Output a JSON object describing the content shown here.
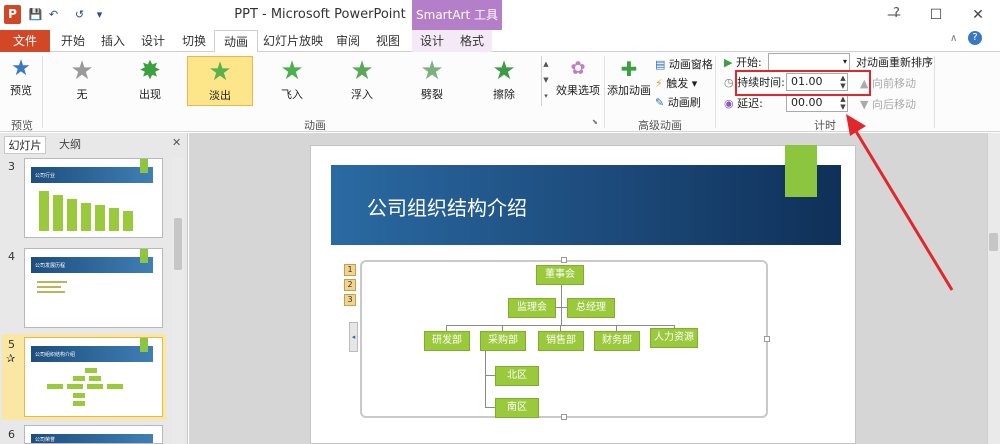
{
  "window": {
    "title": "PPT - Microsoft PowerPoint",
    "contextual_tab_label": "SmartArt 工具",
    "minimize": "—",
    "maximize": "☐",
    "close": "✕"
  },
  "qat": {
    "save": "💾",
    "undo": "↶",
    "redo": "↺",
    "customize": "▾"
  },
  "tabs": [
    "文件",
    "开始",
    "插入",
    "设计",
    "切换",
    "动画",
    "幻灯片放映",
    "审阅",
    "视图",
    "设计",
    "格式"
  ],
  "ribbon": {
    "preview": {
      "label": "预览",
      "group": "预览"
    },
    "animation_group": "动画",
    "animations": [
      {
        "label": "无",
        "color": "#9a9a9a"
      },
      {
        "label": "出现",
        "color": "#3aa040"
      },
      {
        "label": "淡出",
        "color": "#5bb24c"
      },
      {
        "label": "飞入",
        "color": "#4caf50"
      },
      {
        "label": "浮入",
        "color": "#5aa85a"
      },
      {
        "label": "劈裂",
        "color": "#7cb07c"
      },
      {
        "label": "擦除",
        "color": "#3d9a46"
      }
    ],
    "effect_options": "效果选项",
    "advanced_group": "高级动画",
    "add_animation": "添加动画",
    "anim_pane": "动画窗格",
    "trigger": "触发",
    "anim_painter": "动画刷",
    "timing_group": "计时",
    "start_label": "开始:",
    "start_value": "",
    "duration_label": "持续时间:",
    "duration_value": "01.00",
    "delay_label": "延迟:",
    "delay_value": "00.00",
    "reorder_title": "对动画重新排序",
    "move_earlier": "向前移动",
    "move_later": "向后移动"
  },
  "left_panel": {
    "tab_slides": "幻灯片",
    "tab_outline": "大纲",
    "thumbs": [
      {
        "num": "3",
        "text": "公司行业",
        "star": ""
      },
      {
        "num": "4",
        "text": "公司发展历程",
        "star": ""
      },
      {
        "num": "5",
        "text": "公司组织结构介绍",
        "star": "✰"
      },
      {
        "num": "6",
        "text": "公司荣誉",
        "star": ""
      }
    ]
  },
  "slide": {
    "title": "公司组织结构介绍",
    "anim_tags": [
      "1",
      "2",
      "3"
    ],
    "org": {
      "top": "董事会",
      "mid_left": "监理会",
      "mid_right": "总经理",
      "departments": [
        "研发部",
        "采购部",
        "销售部",
        "财务部",
        "人力资源部"
      ],
      "sub": [
        "北区",
        "南区"
      ]
    }
  },
  "colors": {
    "file_tab": "#d24726",
    "smartart": "#b57ec9",
    "org_box": "#9ac93b",
    "highlight": "#e0282c"
  }
}
